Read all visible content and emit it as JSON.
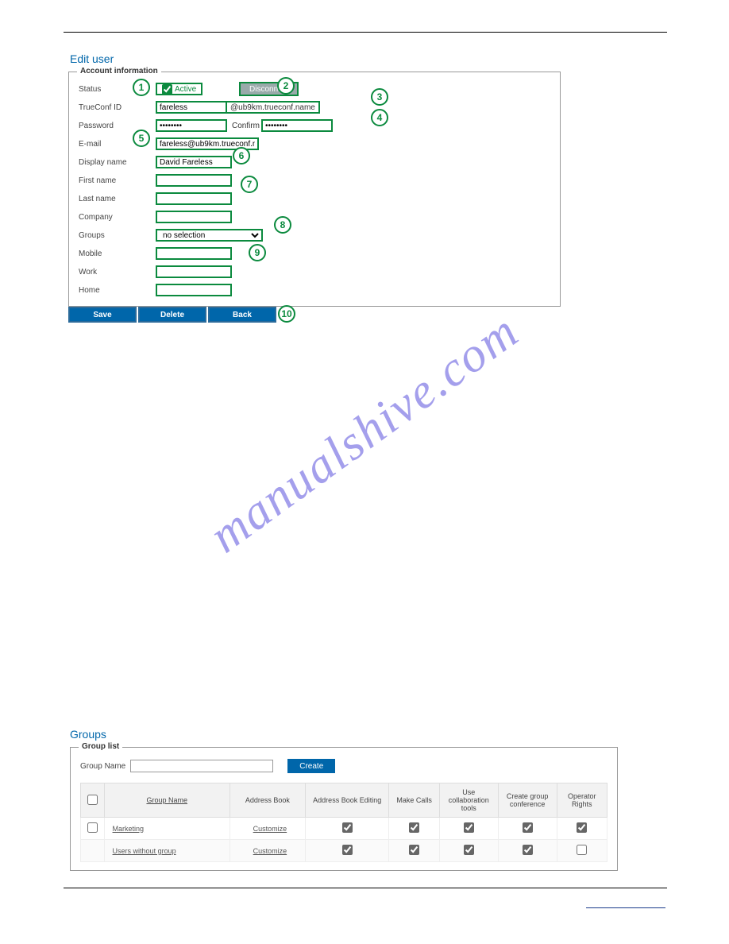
{
  "watermark": "manualshive.com",
  "edit_user": {
    "title": "Edit user",
    "legend": "Account information",
    "labels": {
      "status": "Status",
      "trueconf_id": "TrueConf ID",
      "password": "Password",
      "confirm": "Confirm",
      "email": "E-mail",
      "display_name": "Display name",
      "first_name": "First name",
      "last_name": "Last name",
      "company": "Company",
      "groups": "Groups",
      "mobile": "Mobile",
      "work": "Work",
      "home": "Home"
    },
    "values": {
      "active_label": "Active",
      "active_checked": true,
      "disconnect_btn": "Disconnect",
      "trueconf_id": "fareless",
      "domain": "@ub9km.trueconf.name",
      "password": "••••••••",
      "confirm": "••••••••",
      "email": "fareless@ub9km.trueconf.n",
      "display_name": "David Fareless",
      "first_name": "",
      "last_name": "",
      "company": "",
      "groups_select": "no selection",
      "mobile": "",
      "work": "",
      "home": ""
    },
    "buttons": {
      "save": "Save",
      "delete": "Delete",
      "back": "Back"
    },
    "callouts": [
      "1",
      "2",
      "3",
      "4",
      "5",
      "6",
      "7",
      "8",
      "9",
      "10"
    ]
  },
  "groups": {
    "title": "Groups",
    "legend": "Group list",
    "group_name_label": "Group Name",
    "create_btn": "Create",
    "headers": {
      "group_name": "Group Name",
      "address_book": "Address Book",
      "address_book_editing": "Address Book Editing",
      "make_calls": "Make Calls",
      "use_collab": "Use collaboration tools",
      "create_conf": "Create group conference",
      "operator_rights": "Operator Rights"
    },
    "rows": [
      {
        "name": "Marketing",
        "customize": "Customize",
        "abe": true,
        "mc": true,
        "uc": true,
        "cc": true,
        "or": true
      },
      {
        "name": "Users without group",
        "customize": "Customize",
        "abe": true,
        "mc": true,
        "uc": true,
        "cc": true,
        "or": false
      }
    ]
  }
}
